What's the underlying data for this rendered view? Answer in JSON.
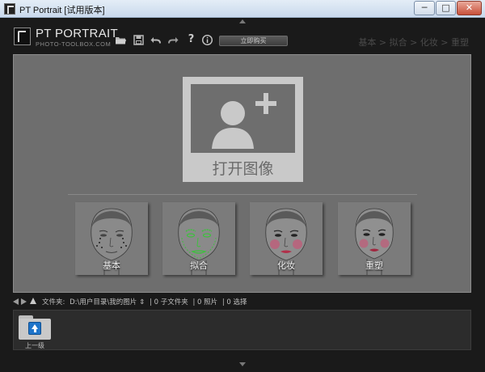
{
  "window": {
    "title": "PT Portrait [试用版本]",
    "minimize_glyph": "─",
    "maximize_glyph": "□",
    "close_glyph": "✕"
  },
  "logo": {
    "name": "PT PORTRAIT",
    "url": "PHOTO-TOOLBOX.COM"
  },
  "toolbar": {
    "icons": [
      "folder-open-icon",
      "save-icon",
      "undo-icon",
      "redo-icon",
      "help-icon",
      "info-icon"
    ],
    "help_glyph": "?",
    "buy_label": "立即购买"
  },
  "steps": {
    "text": "基本 > 拟合 > 化妆 > 重塑"
  },
  "main": {
    "open_label": "打开图像",
    "modes": [
      {
        "label": "基本",
        "icon": "face-basic-icon"
      },
      {
        "label": "拟合",
        "icon": "face-fit-icon"
      },
      {
        "label": "化妆",
        "icon": "face-makeup-icon"
      },
      {
        "label": "重塑",
        "icon": "face-reshape-icon"
      }
    ]
  },
  "pathbar": {
    "folder_label": "文件夹:",
    "path": "D:\\用户目录\\我的图片",
    "path_arrow": "⇕",
    "subfolders": "| 0 子文件夹",
    "photos": "| 0 照片",
    "selected": "| 0 选择"
  },
  "browser": {
    "up_label": "上一级"
  },
  "colors": {
    "frame": "#1a1a1a",
    "panel": "#6e6e6e",
    "card": "#c9c9c9",
    "accent_blue": "#1e74c9",
    "fit_green": "#3fbf3f",
    "lips_red": "#b0304a"
  }
}
